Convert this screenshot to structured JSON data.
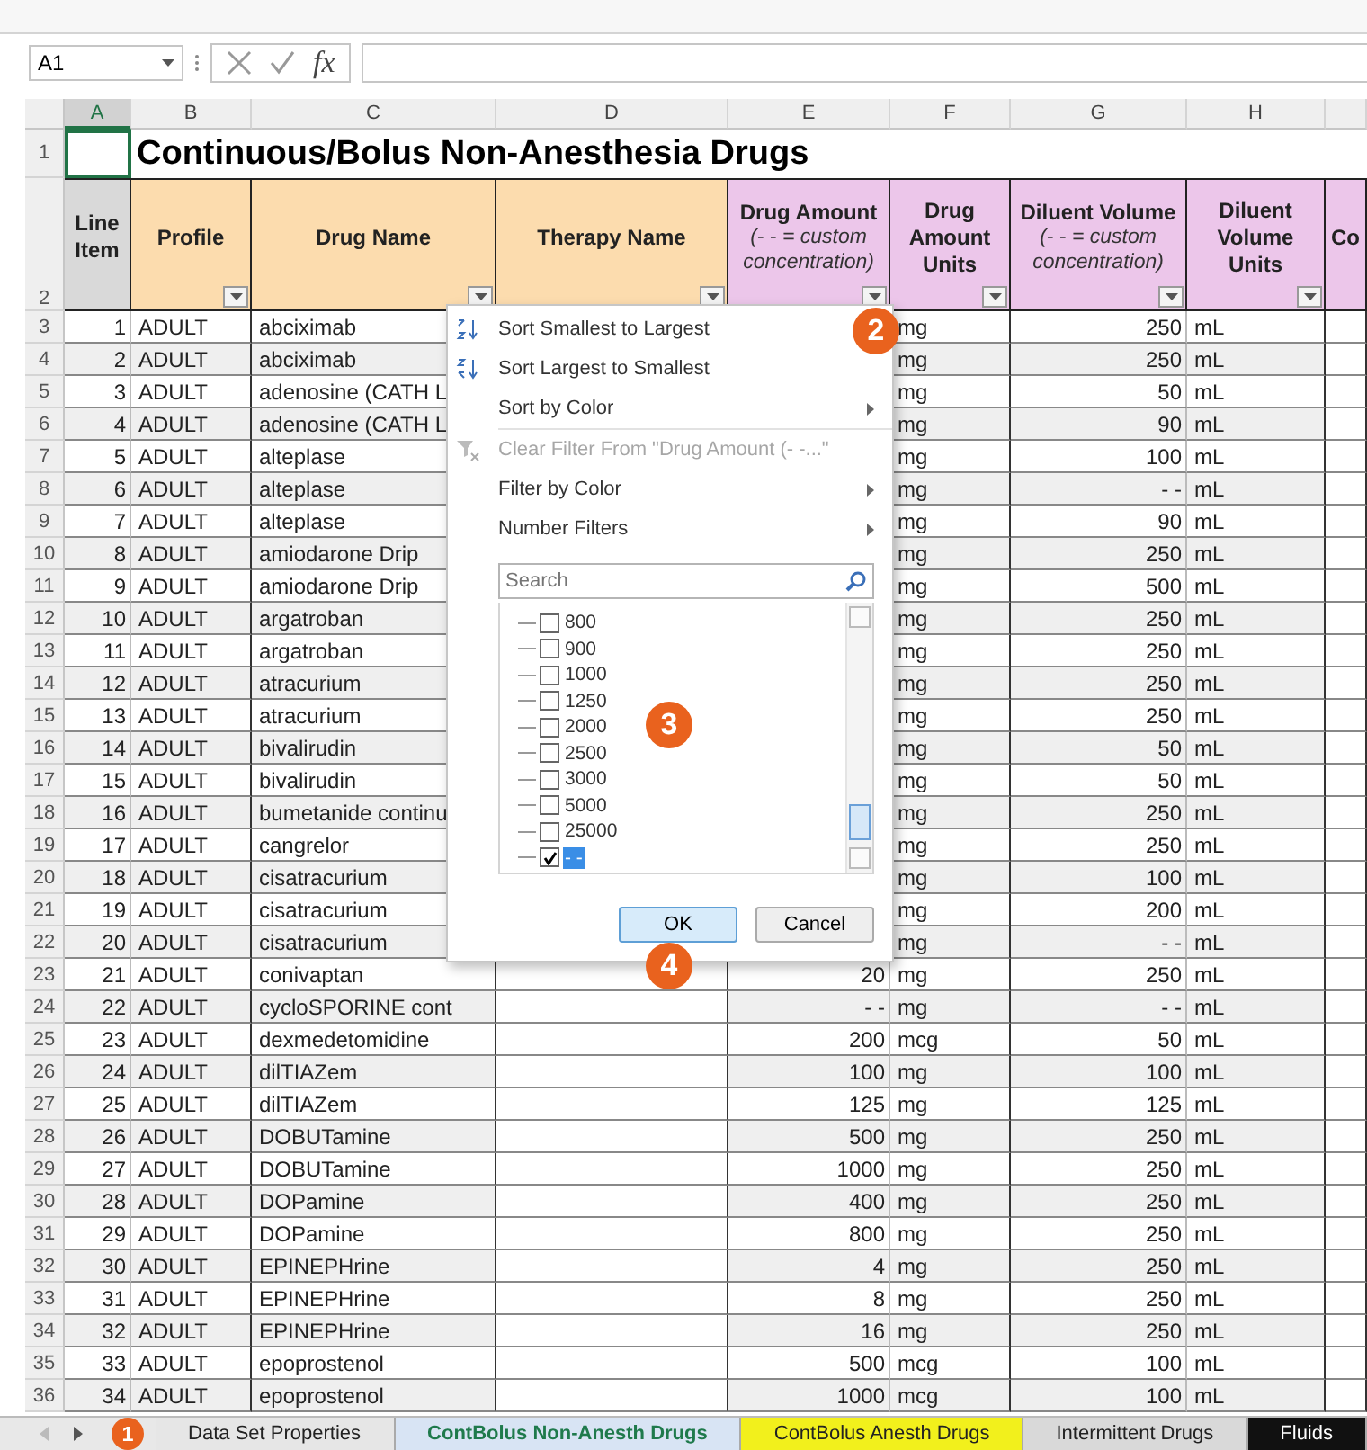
{
  "formula_bar": {
    "name_box": "A1",
    "function_label": "fx"
  },
  "column_letters": [
    {
      "letter": "A",
      "selected": true
    },
    {
      "letter": "B",
      "selected": false
    },
    {
      "letter": "C",
      "selected": false
    },
    {
      "letter": "D",
      "selected": false
    },
    {
      "letter": "E",
      "selected": false
    },
    {
      "letter": "F",
      "selected": false
    },
    {
      "letter": "G",
      "selected": false
    },
    {
      "letter": "H",
      "selected": false
    }
  ],
  "title": "Continuous/Bolus Non-Anesthesia Drugs",
  "row_numbers_header": [
    "1",
    "2"
  ],
  "header_columns": [
    {
      "label": "Line Item",
      "color": "#d9d9d9",
      "filter": false
    },
    {
      "label": "Profile",
      "color": "#fcdcae",
      "filter": true
    },
    {
      "label": "Drug Name",
      "color": "#fcdcae",
      "filter": true
    },
    {
      "label": "Therapy Name",
      "color": "#fcdcae",
      "filter": true
    },
    {
      "label": "Drug Amount",
      "note": "(- - = custom concentration)",
      "color": "#ecc6ea",
      "filter": true
    },
    {
      "label": "Drug Amount Units",
      "color": "#ecc6ea",
      "filter": true
    },
    {
      "label": "Diluent Volume",
      "note": "(- - = custom concentration)",
      "color": "#ecc6ea",
      "filter": true
    },
    {
      "label": "Diluent Volume Units",
      "color": "#ecc6ea",
      "filter": true
    },
    {
      "label": "Co",
      "color": "#ecc6ea",
      "filter": false
    }
  ],
  "rows": [
    {
      "row": "3",
      "line": "1",
      "profile": "ADULT",
      "drug": "abciximab",
      "units": "mg",
      "diluent": "250",
      "diluent_units": "mL"
    },
    {
      "row": "4",
      "line": "2",
      "profile": "ADULT",
      "drug": "abciximab",
      "units": "mg",
      "diluent": "250",
      "diluent_units": "mL"
    },
    {
      "row": "5",
      "line": "3",
      "profile": "ADULT",
      "drug": "adenosine (CATH L",
      "units": "mg",
      "diluent": "50",
      "diluent_units": "mL"
    },
    {
      "row": "6",
      "line": "4",
      "profile": "ADULT",
      "drug": "adenosine (CATH L",
      "units": "mg",
      "diluent": "90",
      "diluent_units": "mL"
    },
    {
      "row": "7",
      "line": "5",
      "profile": "ADULT",
      "drug": "alteplase",
      "units": "mg",
      "diluent": "100",
      "diluent_units": "mL"
    },
    {
      "row": "8",
      "line": "6",
      "profile": "ADULT",
      "drug": "alteplase",
      "units": "mg",
      "diluent": "- -",
      "diluent_units": "mL"
    },
    {
      "row": "9",
      "line": "7",
      "profile": "ADULT",
      "drug": "alteplase",
      "units": "mg",
      "diluent": "90",
      "diluent_units": "mL"
    },
    {
      "row": "10",
      "line": "8",
      "profile": "ADULT",
      "drug": "amiodarone Drip",
      "units": "mg",
      "diluent": "250",
      "diluent_units": "mL"
    },
    {
      "row": "11",
      "line": "9",
      "profile": "ADULT",
      "drug": "amiodarone Drip",
      "units": "mg",
      "diluent": "500",
      "diluent_units": "mL"
    },
    {
      "row": "12",
      "line": "10",
      "profile": "ADULT",
      "drug": "argatroban",
      "units": "mg",
      "diluent": "250",
      "diluent_units": "mL"
    },
    {
      "row": "13",
      "line": "11",
      "profile": "ADULT",
      "drug": "argatroban",
      "units": "mg",
      "diluent": "250",
      "diluent_units": "mL"
    },
    {
      "row": "14",
      "line": "12",
      "profile": "ADULT",
      "drug": "atracurium",
      "units": "mg",
      "diluent": "250",
      "diluent_units": "mL"
    },
    {
      "row": "15",
      "line": "13",
      "profile": "ADULT",
      "drug": "atracurium",
      "units": "mg",
      "diluent": "250",
      "diluent_units": "mL"
    },
    {
      "row": "16",
      "line": "14",
      "profile": "ADULT",
      "drug": "bivalirudin",
      "units": "mg",
      "diluent": "50",
      "diluent_units": "mL"
    },
    {
      "row": "17",
      "line": "15",
      "profile": "ADULT",
      "drug": "bivalirudin",
      "units": "mg",
      "diluent": "50",
      "diluent_units": "mL"
    },
    {
      "row": "18",
      "line": "16",
      "profile": "ADULT",
      "drug": "bumetanide continu",
      "units": "mg",
      "diluent": "250",
      "diluent_units": "mL"
    },
    {
      "row": "19",
      "line": "17",
      "profile": "ADULT",
      "drug": "cangrelor",
      "units": "mg",
      "diluent": "250",
      "diluent_units": "mL"
    },
    {
      "row": "20",
      "line": "18",
      "profile": "ADULT",
      "drug": "cisatracurium",
      "units": "mg",
      "diluent": "100",
      "diluent_units": "mL"
    },
    {
      "row": "21",
      "line": "19",
      "profile": "ADULT",
      "drug": "cisatracurium",
      "units": "mg",
      "diluent": "200",
      "diluent_units": "mL"
    },
    {
      "row": "22",
      "line": "20",
      "profile": "ADULT",
      "drug": "cisatracurium",
      "units": "mg",
      "diluent": "- -",
      "diluent_units": "mL"
    },
    {
      "row": "23",
      "line": "21",
      "profile": "ADULT",
      "drug": "conivaptan",
      "amount": "20",
      "units": "mg",
      "diluent": "250",
      "diluent_units": "mL"
    },
    {
      "row": "24",
      "line": "22",
      "profile": "ADULT",
      "drug": "cycloSPORINE cont",
      "amount": "- -",
      "units": "mg",
      "diluent": "- -",
      "diluent_units": "mL"
    },
    {
      "row": "25",
      "line": "23",
      "profile": "ADULT",
      "drug": "dexmedetomidine",
      "amount": "200",
      "units": "mcg",
      "diluent": "50",
      "diluent_units": "mL"
    },
    {
      "row": "26",
      "line": "24",
      "profile": "ADULT",
      "drug": "dilTIAZem",
      "amount": "100",
      "units": "mg",
      "diluent": "100",
      "diluent_units": "mL"
    },
    {
      "row": "27",
      "line": "25",
      "profile": "ADULT",
      "drug": "dilTIAZem",
      "amount": "125",
      "units": "mg",
      "diluent": "125",
      "diluent_units": "mL"
    },
    {
      "row": "28",
      "line": "26",
      "profile": "ADULT",
      "drug": "DOBUTamine",
      "amount": "500",
      "units": "mg",
      "diluent": "250",
      "diluent_units": "mL"
    },
    {
      "row": "29",
      "line": "27",
      "profile": "ADULT",
      "drug": "DOBUTamine",
      "amount": "1000",
      "units": "mg",
      "diluent": "250",
      "diluent_units": "mL"
    },
    {
      "row": "30",
      "line": "28",
      "profile": "ADULT",
      "drug": "DOPamine",
      "amount": "400",
      "units": "mg",
      "diluent": "250",
      "diluent_units": "mL"
    },
    {
      "row": "31",
      "line": "29",
      "profile": "ADULT",
      "drug": "DOPamine",
      "amount": "800",
      "units": "mg",
      "diluent": "250",
      "diluent_units": "mL"
    },
    {
      "row": "32",
      "line": "30",
      "profile": "ADULT",
      "drug": "EPINEPHrine",
      "amount": "4",
      "units": "mg",
      "diluent": "250",
      "diluent_units": "mL"
    },
    {
      "row": "33",
      "line": "31",
      "profile": "ADULT",
      "drug": "EPINEPHrine",
      "amount": "8",
      "units": "mg",
      "diluent": "250",
      "diluent_units": "mL"
    },
    {
      "row": "34",
      "line": "32",
      "profile": "ADULT",
      "drug": "EPINEPHrine",
      "amount": "16",
      "units": "mg",
      "diluent": "250",
      "diluent_units": "mL"
    },
    {
      "row": "35",
      "line": "33",
      "profile": "ADULT",
      "drug": "epoprostenol",
      "amount": "500",
      "units": "mcg",
      "diluent": "100",
      "diluent_units": "mL"
    },
    {
      "row": "36",
      "line": "34",
      "profile": "ADULT",
      "drug": "epoprostenol",
      "amount": "1000",
      "units": "mcg",
      "diluent": "100",
      "diluent_units": "mL"
    }
  ],
  "filter_menu": {
    "items": [
      {
        "kind": "sort_asc",
        "label": "Sort Smallest to Largest",
        "disabled": false
      },
      {
        "kind": "sort_desc",
        "label": "Sort Largest to Smallest",
        "disabled": false
      },
      {
        "kind": "submenu",
        "label": "Sort by Color",
        "disabled": false
      },
      {
        "kind": "clear",
        "label": "Clear Filter From \"Drug Amount  (- -...\"",
        "disabled": true
      },
      {
        "kind": "submenu",
        "label": "Filter by Color",
        "disabled": false
      },
      {
        "kind": "submenu",
        "label": "Number Filters",
        "disabled": false
      }
    ],
    "search": {
      "placeholder": "Search"
    },
    "values": [
      {
        "label": "800",
        "checked": false,
        "selected": false
      },
      {
        "label": "900",
        "checked": false,
        "selected": false
      },
      {
        "label": "1000",
        "checked": false,
        "selected": false
      },
      {
        "label": "1250",
        "checked": false,
        "selected": false
      },
      {
        "label": "2000",
        "checked": false,
        "selected": false
      },
      {
        "label": "2500",
        "checked": false,
        "selected": false
      },
      {
        "label": "3000",
        "checked": false,
        "selected": false
      },
      {
        "label": "5000",
        "checked": false,
        "selected": false
      },
      {
        "label": "25000",
        "checked": false,
        "selected": false
      },
      {
        "label": "- -",
        "checked": true,
        "selected": true
      }
    ],
    "buttons": [
      {
        "label": "OK",
        "default": true
      },
      {
        "label": "Cancel",
        "default": false
      }
    ]
  },
  "sheet_tabs": [
    {
      "label": "Data Set Properties",
      "selected": false,
      "color": "#e6e6e6"
    },
    {
      "label": "ContBolus Non-Anesth Drugs",
      "selected": true,
      "color": "#d8e4f4"
    },
    {
      "label": "ContBolus Anesth Drugs",
      "selected": false,
      "color": "#f2f01c"
    },
    {
      "label": "Intermittent Drugs",
      "selected": false,
      "color": "#d9d9d9"
    },
    {
      "label": "Fluids",
      "selected": false,
      "color": "#111111"
    }
  ],
  "callouts": [
    "1",
    "2",
    "3",
    "4"
  ]
}
